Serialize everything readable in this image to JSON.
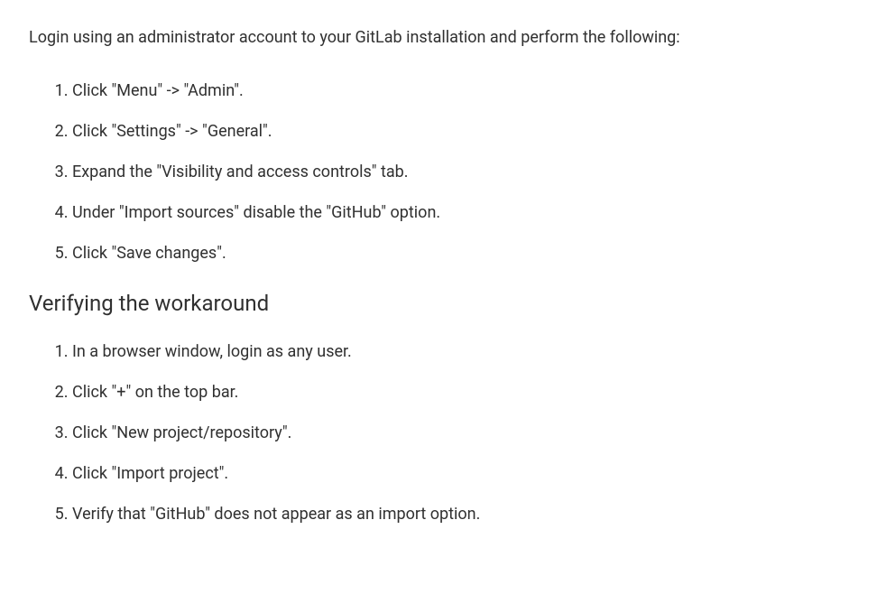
{
  "intro": "Login using an administrator account to your GitLab installation and perform the following:",
  "steps": {
    "s1": "Click \"Menu\" -> \"Admin\".",
    "s2": "Click \"Settings\" -> \"General\".",
    "s3": "Expand the \"Visibility and access controls\" tab.",
    "s4": "Under \"Import sources\" disable the \"GitHub\" option.",
    "s5": "Click \"Save changes\"."
  },
  "verifyHeading": "Verifying the workaround",
  "verifySteps": {
    "v1": "In a browser window, login as any user.",
    "v2": "Click \"+\" on the top bar.",
    "v3": "Click \"New project/repository\".",
    "v4": "Click \"Import project\".",
    "v5": "Verify that \"GitHub\" does not appear as an import option."
  }
}
